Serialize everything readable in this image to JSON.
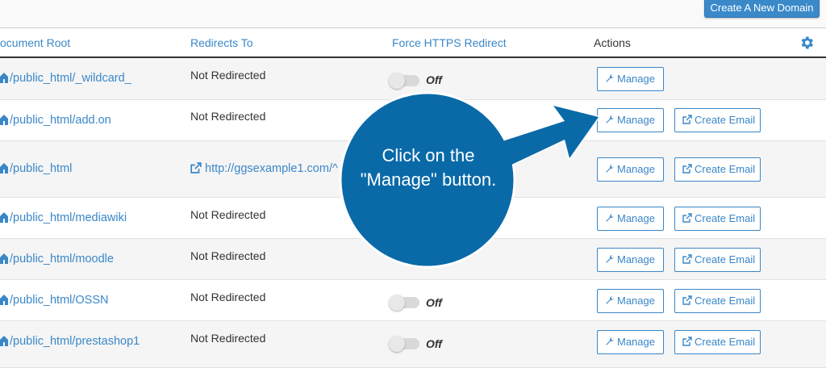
{
  "toolbar": {
    "create_domain_label": "Create A New Domain"
  },
  "table": {
    "headers": {
      "document_root": "ocument Root",
      "redirects_to": "Redirects To",
      "force_https": "Force HTTPS Redirect",
      "actions": "Actions"
    },
    "rows": [
      {
        "doc_root": "/public_html/_wildcard_",
        "redirect": "Not Redirected",
        "https": "Off",
        "manage": "Manage"
      },
      {
        "doc_root": "/public_html/add.on",
        "redirect": "Not Redirected",
        "https": "",
        "manage": "Manage",
        "email": "Create Email"
      },
      {
        "doc_root": "/public_html",
        "redirect": "http://ggsexample1.com/^",
        "https": "",
        "manage": "Manage",
        "email": "Create Email"
      },
      {
        "doc_root": "/public_html/mediawiki",
        "redirect": "Not Redirected",
        "https": "",
        "manage": "Manage",
        "email": "Create Email"
      },
      {
        "doc_root": "/public_html/moodle",
        "redirect": "Not Redirected",
        "https": "",
        "manage": "Manage",
        "email": "Create Email"
      },
      {
        "doc_root": "/public_html/OSSN",
        "redirect": "Not Redirected",
        "https": "Off",
        "manage": "Manage",
        "email": "Create Email"
      },
      {
        "doc_root": "/public_html/prestashop1",
        "redirect": "Not Redirected",
        "https": "Off",
        "manage": "Manage",
        "email": "Create Email"
      }
    ]
  },
  "callout": {
    "text": "Click on the \"Manage\" button."
  },
  "colors": {
    "accent": "#3a87c8",
    "callout": "#0a6aa8",
    "button": "#3a89c9"
  }
}
